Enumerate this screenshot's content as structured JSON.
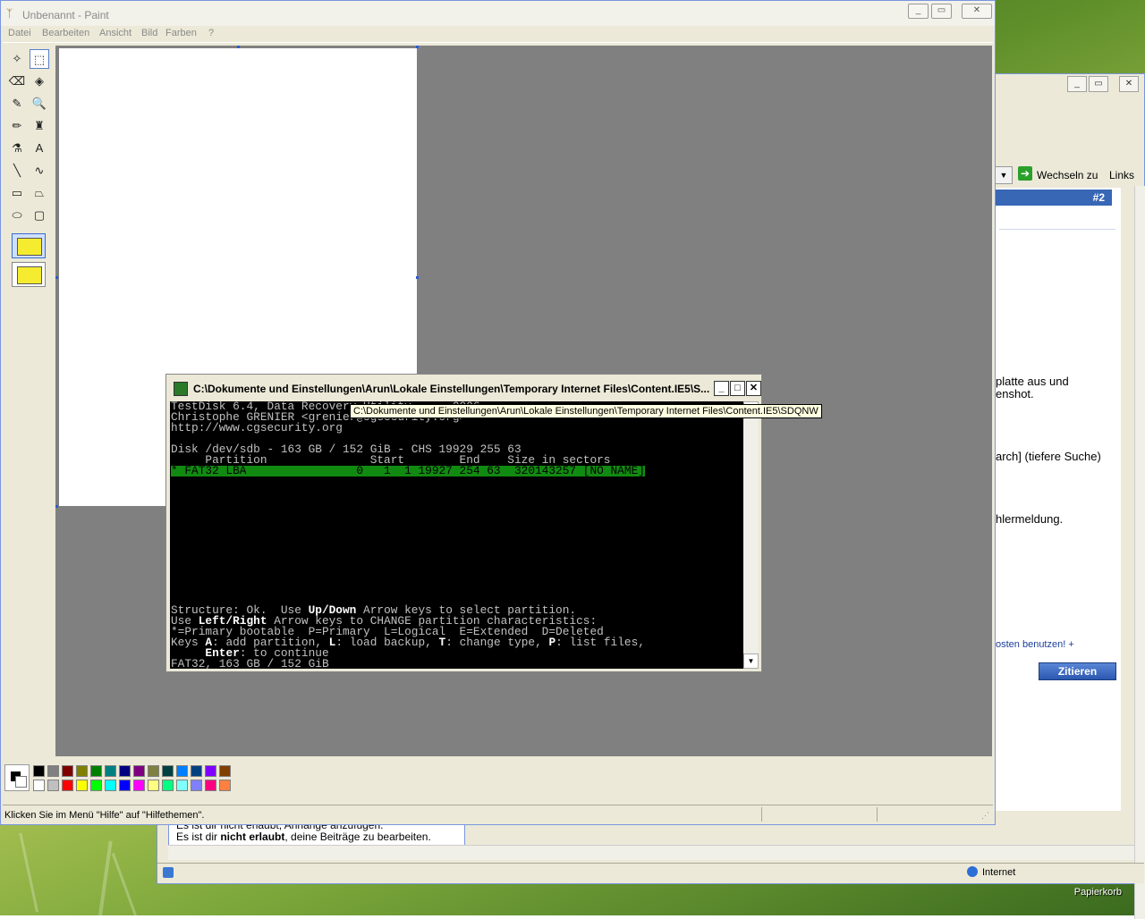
{
  "desktop": {
    "recycle_bin": "Papierkorb"
  },
  "ie": {
    "toolbar": {
      "go_label": "Wechseln zu",
      "links_label": "Links"
    },
    "post_number": "#2",
    "text_fragments": [
      "platte aus und",
      "enshot.",
      "arch] (tiefere Suche)",
      "hlermeldung.",
      "osten benutzen! +"
    ],
    "quote_button": "Zitieren",
    "permissions": {
      "line1_partial": "Es ist dir nicht erlaubt, Anhänge anzufügen.",
      "line2_prefix": "Es ist dir ",
      "line2_bold": "nicht erlaubt",
      "line2_suffix": ", deine Beiträge zu bearbeiten."
    },
    "status_zone": "Internet"
  },
  "paint": {
    "title": "Unbenannt - Paint",
    "menu": [
      "Datei",
      "Bearbeiten",
      "Ansicht",
      "Bild",
      "Farben",
      "?"
    ],
    "tools": [
      {
        "name": "free-select-icon",
        "glyph": "✧"
      },
      {
        "name": "rect-select-icon",
        "glyph": "⬚"
      },
      {
        "name": "eraser-icon",
        "glyph": "⌫"
      },
      {
        "name": "fill-bucket-icon",
        "glyph": "◈"
      },
      {
        "name": "color-picker-icon",
        "glyph": "✎"
      },
      {
        "name": "magnifier-icon",
        "glyph": "🔍"
      },
      {
        "name": "pencil-icon",
        "glyph": "✏"
      },
      {
        "name": "brush-icon",
        "glyph": "♜"
      },
      {
        "name": "airbrush-icon",
        "glyph": "⚗"
      },
      {
        "name": "text-icon",
        "glyph": "A"
      },
      {
        "name": "line-icon",
        "glyph": "╲"
      },
      {
        "name": "curve-icon",
        "glyph": "∿"
      },
      {
        "name": "rectangle-icon",
        "glyph": "▭"
      },
      {
        "name": "polygon-icon",
        "glyph": "⏢"
      },
      {
        "name": "ellipse-icon",
        "glyph": "⬭"
      },
      {
        "name": "rounded-rect-icon",
        "glyph": "▢"
      }
    ],
    "palette": {
      "top": [
        "#000000",
        "#808080",
        "#800000",
        "#808000",
        "#008000",
        "#008080",
        "#000080",
        "#800080",
        "#808040",
        "#004040",
        "#0080ff",
        "#004080",
        "#8000ff",
        "#804000"
      ],
      "bottom": [
        "#ffffff",
        "#c0c0c0",
        "#ff0000",
        "#ffff00",
        "#00ff00",
        "#00ffff",
        "#0000ff",
        "#ff00ff",
        "#ffff80",
        "#00ff80",
        "#80ffff",
        "#8080ff",
        "#ff0080",
        "#ff8040"
      ]
    },
    "status": "Klicken Sie im Menü \"Hilfe\" auf \"Hilfethemen\"."
  },
  "console": {
    "title": "C:\\Dokumente und Einstellungen\\Arun\\Lokale Einstellungen\\Temporary Internet Files\\Content.IE5\\S...",
    "tooltip": "C:\\Dokumente und Einstellungen\\Arun\\Lokale Einstellungen\\Temporary Internet Files\\Content.IE5\\SDQNW",
    "lines": [
      "TestDisk 6.4, Data Recovery Utility, ... 2006",
      "Christophe GRENIER <grenier@cgsecurity.org>",
      "http://www.cgsecurity.org",
      "",
      "Disk /dev/sdb - 163 GB / 152 GiB - CHS 19929 255 63",
      "     Partition               Start        End    Size in sectors",
      "* FAT32 LBA                0   1  1 19927 254 63  320143257 [NO NAME]"
    ],
    "help": {
      "l1a": "Structure: Ok.  Use ",
      "l1b": "Up/Down",
      "l1c": " Arrow keys to select partition.",
      "l2a": "Use ",
      "l2b": "Left/Right",
      "l2c": " Arrow keys to CHANGE partition characteristics:",
      "l3": "*=Primary bootable  P=Primary  L=Logical  E=Extended  D=Deleted",
      "l4a": "Keys ",
      "l4b": "A",
      "l4c": ": add partition, ",
      "l4d": "L",
      "l4e": ": load backup, ",
      "l4f": "T",
      "l4g": ": change type, ",
      "l4h": "P",
      "l4i": ": list files,",
      "l5a": "     ",
      "l5b": "Enter",
      "l5c": ": to continue",
      "l6": "FAT32, 163 GB / 152 GiB"
    }
  }
}
